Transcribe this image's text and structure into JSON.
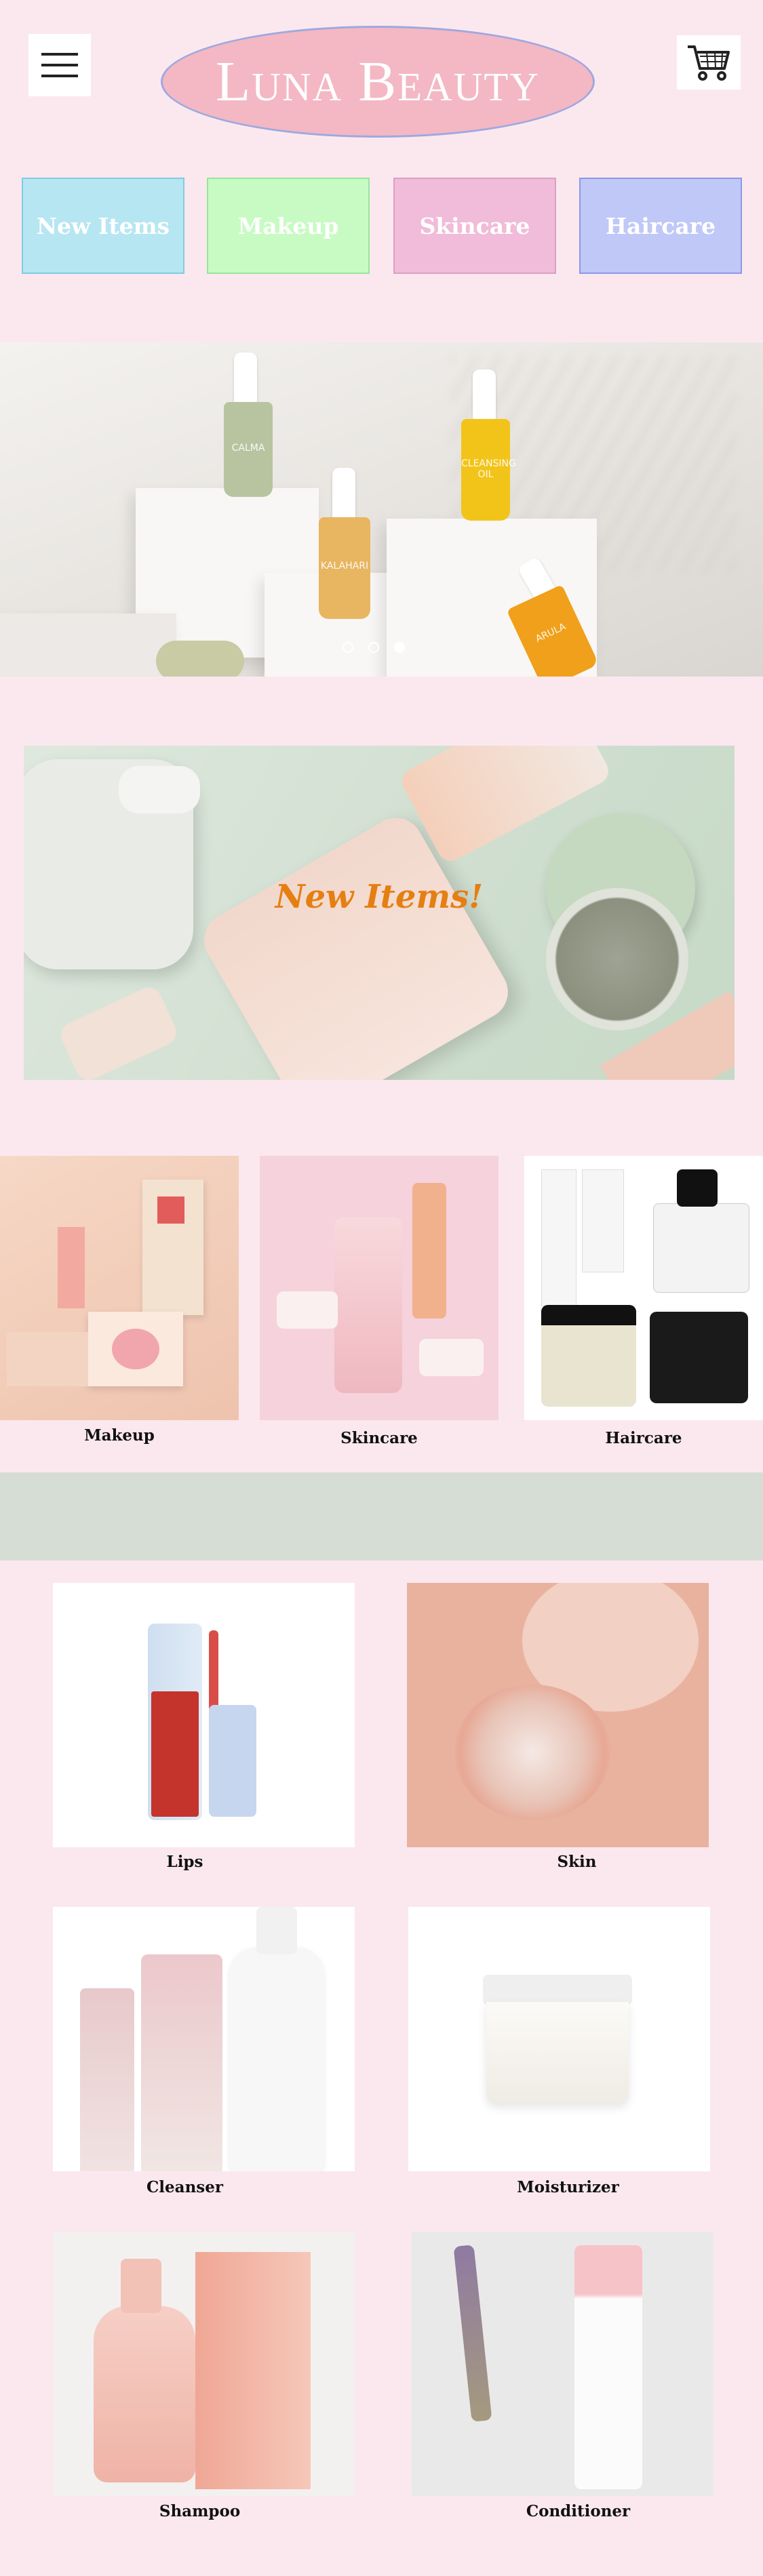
{
  "header": {
    "menu_icon": "hamburger-menu-icon",
    "brand": "Luna Beauty",
    "cart_icon": "shopping-cart-icon"
  },
  "nav_tabs": [
    {
      "label": "New Items",
      "color": "#b6e6f2"
    },
    {
      "label": "Makeup",
      "color": "#c8fbc4"
    },
    {
      "label": "Skincare",
      "color": "#f0bcd9"
    },
    {
      "label": "Haircare",
      "color": "#c0c8f7"
    }
  ],
  "hero": {
    "bottles": [
      {
        "label": "CALMA"
      },
      {
        "label": "KALAHARI"
      },
      {
        "label": "CLEANSING OIL"
      },
      {
        "label": "ARULA"
      }
    ],
    "carousel": {
      "slide_count": 3,
      "active_slide": 3
    }
  },
  "promo": {
    "text": "New Items!"
  },
  "categories": [
    {
      "label": "Makeup"
    },
    {
      "label": "Skincare"
    },
    {
      "label": "Haircare"
    }
  ],
  "products": [
    {
      "label": "Lips"
    },
    {
      "label": "Skin"
    },
    {
      "label": "Cleanser"
    },
    {
      "label": "Moisturizer"
    },
    {
      "label": "Shampoo"
    },
    {
      "label": "Conditioner"
    }
  ],
  "colors": {
    "page_background": "#fbe8ef",
    "logo_fill": "#f3b8c4",
    "promo_text": "#e57f12"
  }
}
